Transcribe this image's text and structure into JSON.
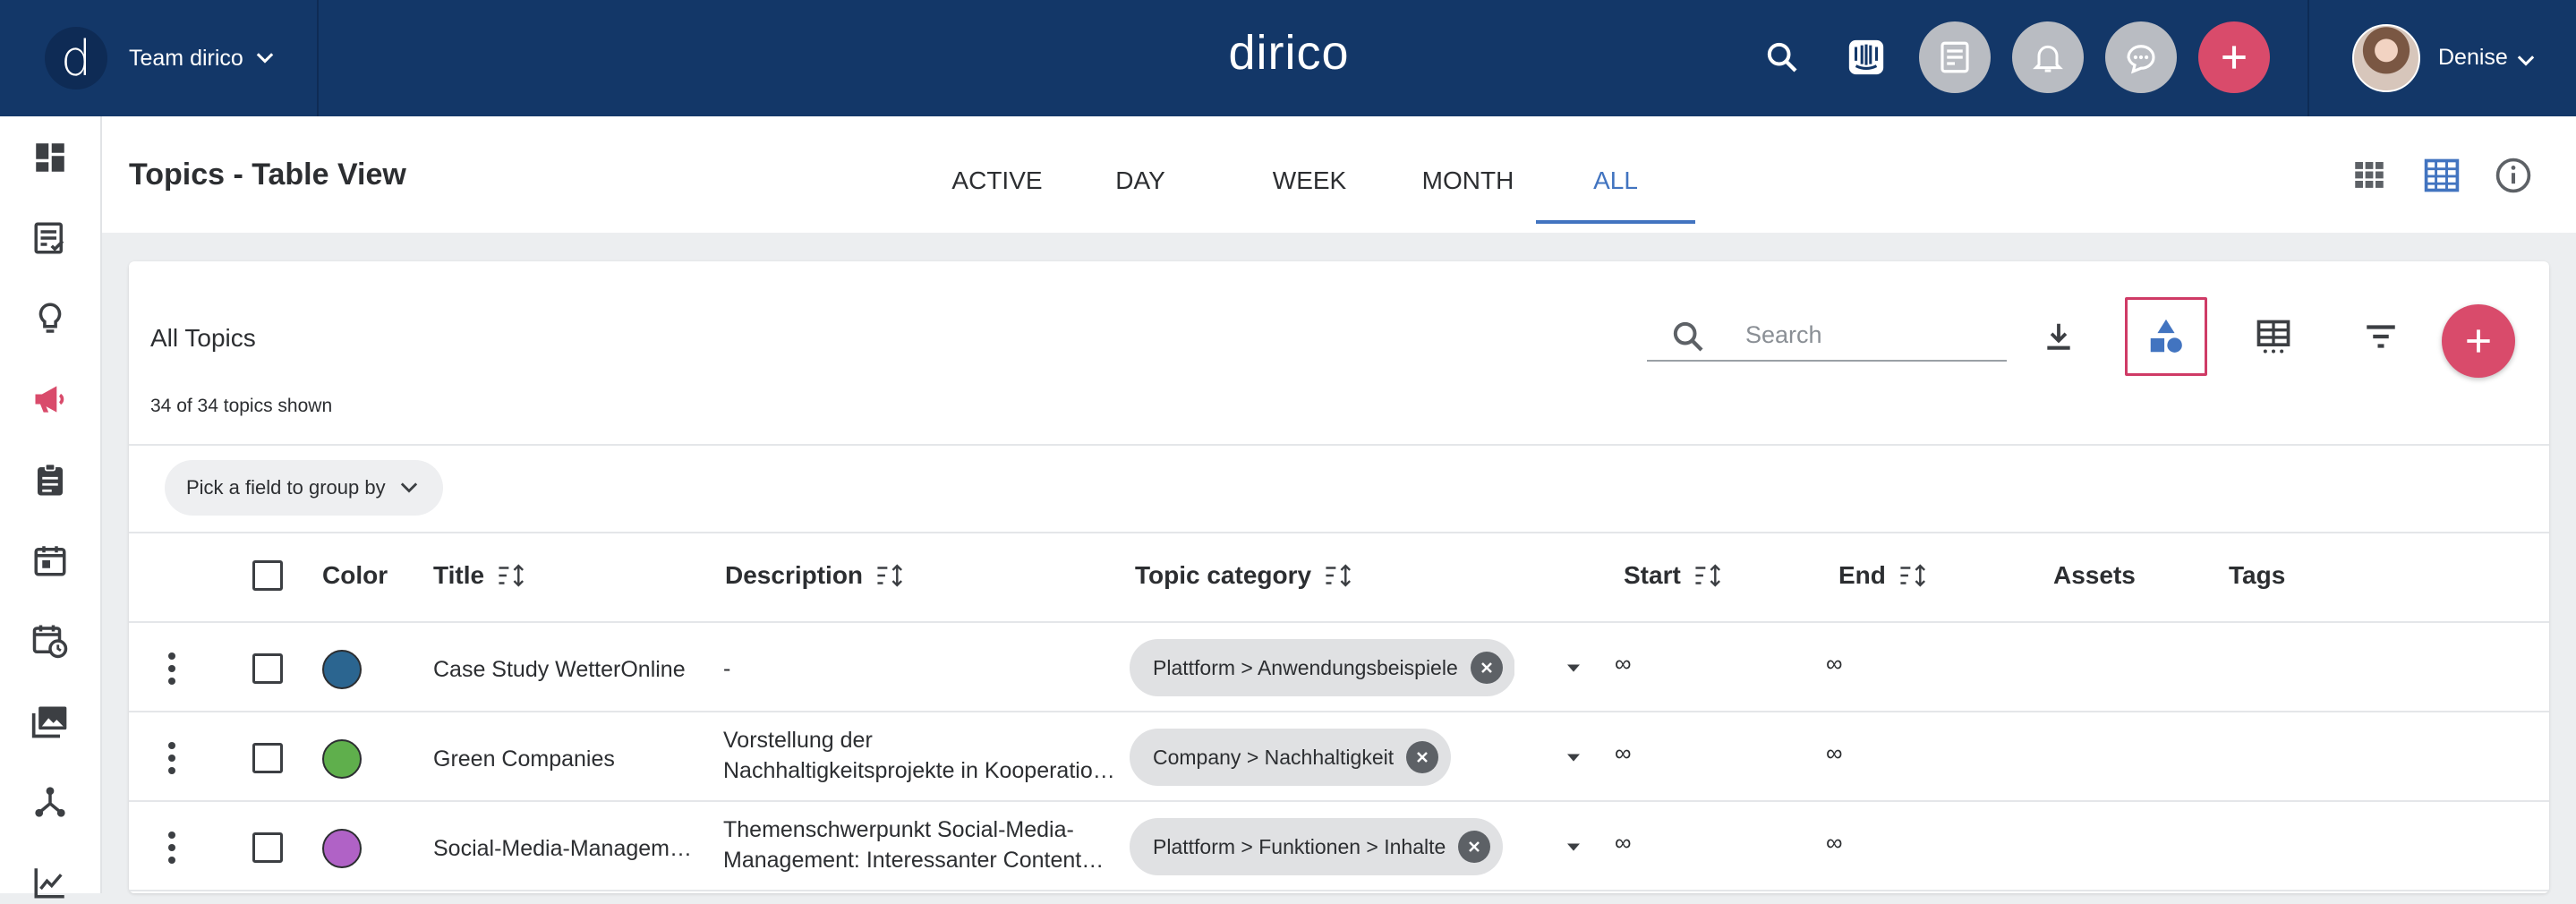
{
  "topbar": {
    "team_initial": "d",
    "team_name": "Team dirico",
    "brand": "dirico",
    "user_name": "Denise"
  },
  "page": {
    "title": "Topics - Table View",
    "tabs": [
      {
        "label": "ACTIVE"
      },
      {
        "label": "DAY"
      },
      {
        "label": "WEEK"
      },
      {
        "label": "MONTH"
      },
      {
        "label": "ALL",
        "active": true
      }
    ]
  },
  "card": {
    "title": "All Topics",
    "count_text": "34 of 34 topics shown",
    "search_placeholder": "Search",
    "group_by_label": "Pick a field to group by"
  },
  "table": {
    "columns": [
      {
        "label": "Color"
      },
      {
        "label": "Title"
      },
      {
        "label": "Description"
      },
      {
        "label": "Topic category"
      },
      {
        "label": "Start"
      },
      {
        "label": "End"
      },
      {
        "label": "Assets"
      },
      {
        "label": "Tags"
      }
    ],
    "rows": [
      {
        "color": "#2b6590",
        "title": "Case Study WetterOnline",
        "description_1": "-",
        "description_2": "",
        "category": "Plattform > Anwendungsbeispiele",
        "start": "∞",
        "end": "∞"
      },
      {
        "color": "#5faf4c",
        "title": "Green Companies",
        "description_1": "Vorstellung der",
        "description_2": "Nachhaltigkeitsprojekte in Kooperatio…",
        "category": "Company > Nachhaltigkeit",
        "start": "∞",
        "end": "∞"
      },
      {
        "color": "#b062c6",
        "title": "Social-Media-Managem…",
        "description_1": "Themenschwerpunkt Social-Media-",
        "description_2": "Management: Interessanter Content…",
        "category": "Plattform > Funktionen > Inhalte",
        "start": "∞",
        "end": "∞"
      }
    ]
  },
  "colors": {
    "topbar": "#133768",
    "accent": "#4274c0",
    "action": "#d94b6b",
    "highlight_border": "#cf3b66"
  }
}
